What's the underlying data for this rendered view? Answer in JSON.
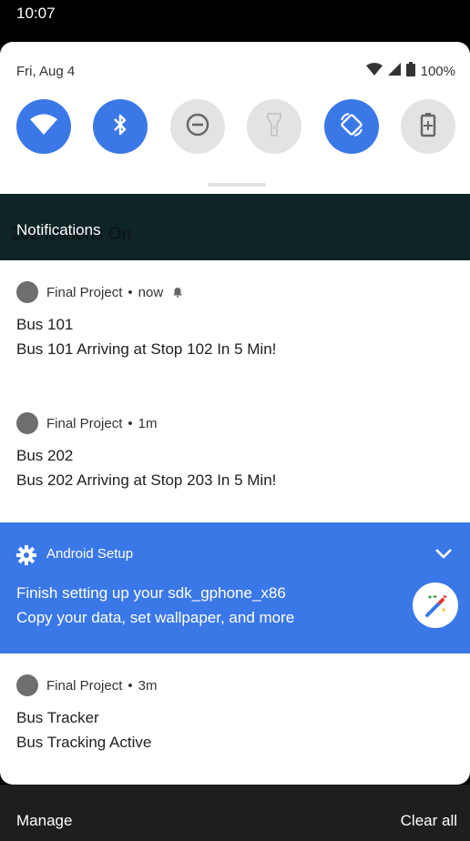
{
  "status_bar": {
    "time": "10:07"
  },
  "quick_settings": {
    "date": "Fri, Aug 4",
    "battery_percent": "100%",
    "tiles": [
      {
        "name": "wifi",
        "state": "on"
      },
      {
        "name": "bluetooth",
        "state": "on"
      },
      {
        "name": "do-not-disturb",
        "state": "off"
      },
      {
        "name": "flashlight",
        "state": "off"
      },
      {
        "name": "auto-rotate",
        "state": "on"
      },
      {
        "name": "battery-saver",
        "state": "off"
      }
    ]
  },
  "notifications_header": {
    "title": "Notifications",
    "ghost_text": "202   ications On"
  },
  "notifications": [
    {
      "app": "Final Project",
      "separator": "•",
      "time": "now",
      "title": "Bus 101",
      "text": "Bus 101 Arriving at Stop 102 In 5 Min!"
    },
    {
      "app": "Final Project",
      "separator": "•",
      "time": "1m",
      "title": "Bus 202",
      "text": "Bus 202 Arriving at Stop 203 In 5 Min!"
    },
    {
      "app": "Final Project",
      "separator": "•",
      "time": "3m",
      "title": "Bus Tracker",
      "text": "Bus Tracking Active"
    }
  ],
  "setup_notification": {
    "app": "Android Setup",
    "title": "Finish setting up your sdk_gphone_x86",
    "text": "Copy your data, set wallpaper, and more"
  },
  "footer": {
    "manage_label": "Manage",
    "clear_all_label": "Clear all"
  },
  "colors": {
    "accent": "#3b78e7",
    "header_bg": "#0f2427",
    "tile_off": "#e3e3e3",
    "footer_bg": "#1e1e1e"
  }
}
